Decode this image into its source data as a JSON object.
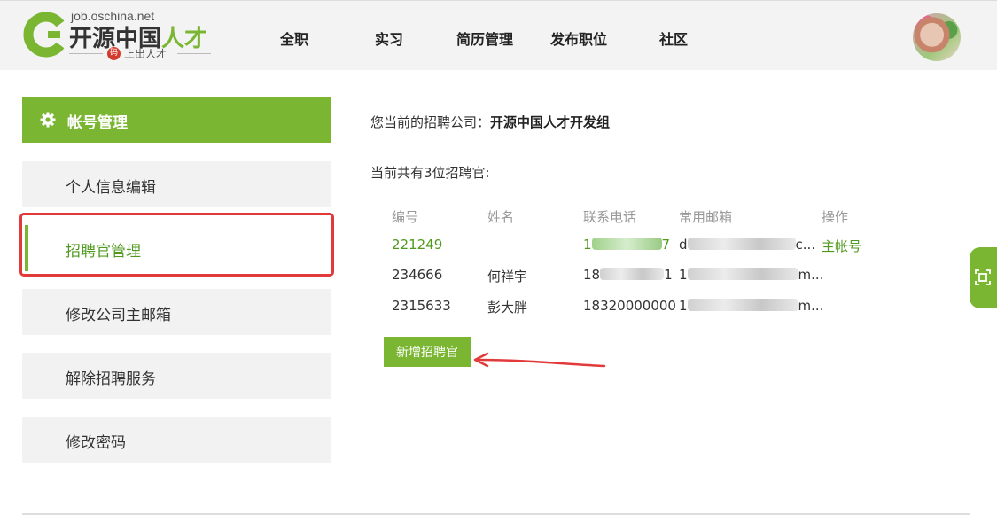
{
  "header": {
    "logo": {
      "domain": "job.oschina.net",
      "name_main": "开源中国",
      "name_accent": "人才",
      "seal": "码",
      "slogan": "上出人才"
    },
    "nav": [
      "全职",
      "实习",
      "简历管理",
      "发布职位",
      "社区"
    ],
    "avatar": "user-avatar"
  },
  "sidebar": {
    "heading": "帐号管理",
    "items": [
      {
        "label": "个人信息编辑",
        "active": false
      },
      {
        "label": "招聘官管理",
        "active": true
      },
      {
        "label": "修改公司主邮箱",
        "active": false
      },
      {
        "label": "解除招聘服务",
        "active": false
      },
      {
        "label": "修改密码",
        "active": false
      }
    ]
  },
  "main": {
    "company_prefix": "您当前的招聘公司：",
    "company_name": "开源中国人才开发组",
    "count_text": "当前共有3位招聘官:",
    "table": {
      "headers": [
        "编号",
        "姓名",
        "联系电话",
        "常用邮箱",
        "操作"
      ],
      "rows": [
        {
          "id": "221249",
          "name": "",
          "phone_prefix": "1",
          "phone_suffix": "7",
          "email_prefix": "d",
          "email_suffix": "c...",
          "action": "主帐号"
        },
        {
          "id": "234666",
          "name": "何祥宇",
          "phone_prefix": "18",
          "phone_suffix": "1",
          "email_prefix": "1",
          "email_suffix": "m...",
          "action": ""
        },
        {
          "id": "2315633",
          "name": "彭大胖",
          "phone": "18320000000",
          "email_prefix": "1",
          "email_suffix": "m...",
          "action": ""
        }
      ]
    },
    "add_button": "新增招聘官"
  },
  "colors": {
    "accent": "#7ab632",
    "annotation": "#e23a3a"
  }
}
